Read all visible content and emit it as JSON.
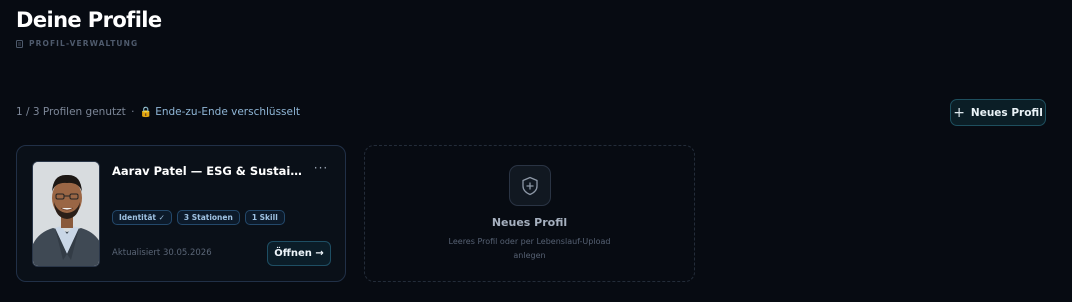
{
  "header": {
    "title": "Deine Profile",
    "subtitle": "PROFIL-VERWALTUNG",
    "subtitle_icon": "file-icon"
  },
  "status": {
    "usage": "1 / 3 Profilen genutzt",
    "separator": "·",
    "lock_icon": "🔒",
    "encryption": "Ende-zu-Ende verschlüsselt"
  },
  "actions": {
    "new_profile_label": "Neues Profil",
    "new_profile_icon": "plus-icon"
  },
  "profiles": [
    {
      "name": "Aarav Patel — ESG & Sustainabili...",
      "menu": "···",
      "tags": [
        "Identität ✓",
        "3 Stationen",
        "1 Skill"
      ],
      "updated": "Aktualisiert 30.05.2026",
      "open_label": "Öffnen →"
    }
  ],
  "new_profile_card": {
    "icon": "shield-plus-icon",
    "title": "Neues Profil",
    "description": "Leeres Profil oder per Lebenslauf-Upload anlegen"
  },
  "colors": {
    "background": "#070b12",
    "accent": "#8fb6d6",
    "tag_text": "#9fc2e2",
    "card_border": "#213047"
  }
}
